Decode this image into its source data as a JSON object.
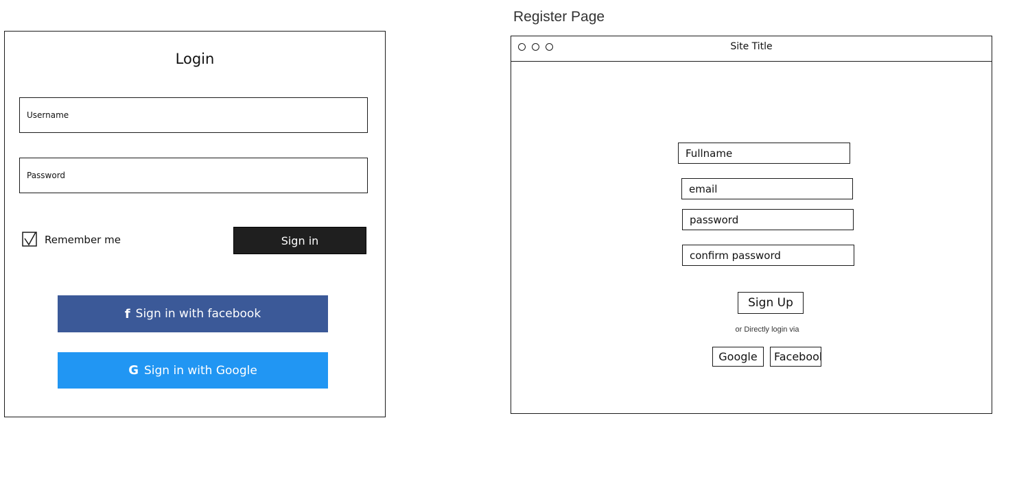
{
  "login": {
    "title": "Login",
    "username_placeholder": "Username",
    "password_placeholder": "Password",
    "remember_label": "Remember me",
    "remember_checked": true,
    "signin_label": "Sign in",
    "facebook_label": "Sign in with facebook",
    "google_label": "Sign in with Google",
    "facebook_icon": "f",
    "google_icon": "G",
    "colors": {
      "facebook": "#3b5998",
      "google": "#2196f3",
      "signin": "#1f1f1f"
    }
  },
  "register": {
    "heading": "Register Page",
    "site_title": "Site Title",
    "fullname_placeholder": "Fullname",
    "email_placeholder": "email",
    "password_placeholder": "password",
    "confirm_placeholder": "confirm password",
    "signup_label": "Sign Up",
    "direct_text": "or Directly login via",
    "google_label": "Google",
    "facebook_label": "Facebook"
  }
}
